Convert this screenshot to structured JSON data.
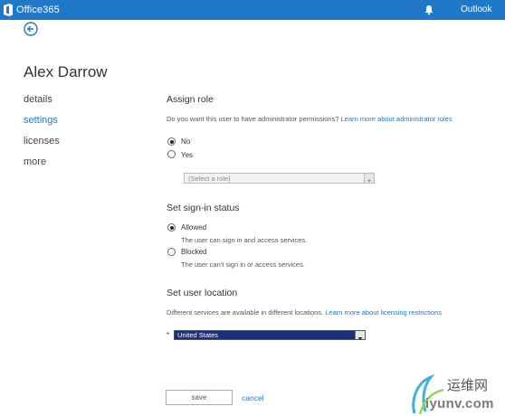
{
  "header": {
    "app_name": "Office365",
    "outlook_label": "Outlook",
    "colors": {
      "bar": "#1f78c8",
      "text": "#ffffff"
    }
  },
  "user": {
    "name": "Alex Darrow"
  },
  "nav": {
    "items": [
      {
        "label": "details",
        "active": false
      },
      {
        "label": "settings",
        "active": true
      },
      {
        "label": "licenses",
        "active": false
      },
      {
        "label": "more",
        "active": false
      }
    ]
  },
  "assign_role": {
    "heading": "Assign role",
    "question": "Do you want this user to have administrator permissions?",
    "learn_more": "Learn more about administrator roles",
    "options": [
      {
        "label": "No",
        "checked": true
      },
      {
        "label": "Yes",
        "checked": false
      }
    ],
    "role_select_value": "(Select a role)"
  },
  "signin_status": {
    "heading": "Set sign-in status",
    "options": [
      {
        "label": "Allowed",
        "description": "The user can sign in and access services.",
        "checked": true
      },
      {
        "label": "Blocked",
        "description": "The user can't sign in or access services.",
        "checked": false
      }
    ]
  },
  "location": {
    "heading": "Set user location",
    "description": "Different services are available in different locations.",
    "learn_more": "Learn more about licensing restrictions",
    "required_marker": "*",
    "selected": "United States"
  },
  "actions": {
    "save_label": "save",
    "cancel_label": "cancel"
  },
  "watermark": {
    "line1": "运维网",
    "line2": "iyunv.com"
  }
}
